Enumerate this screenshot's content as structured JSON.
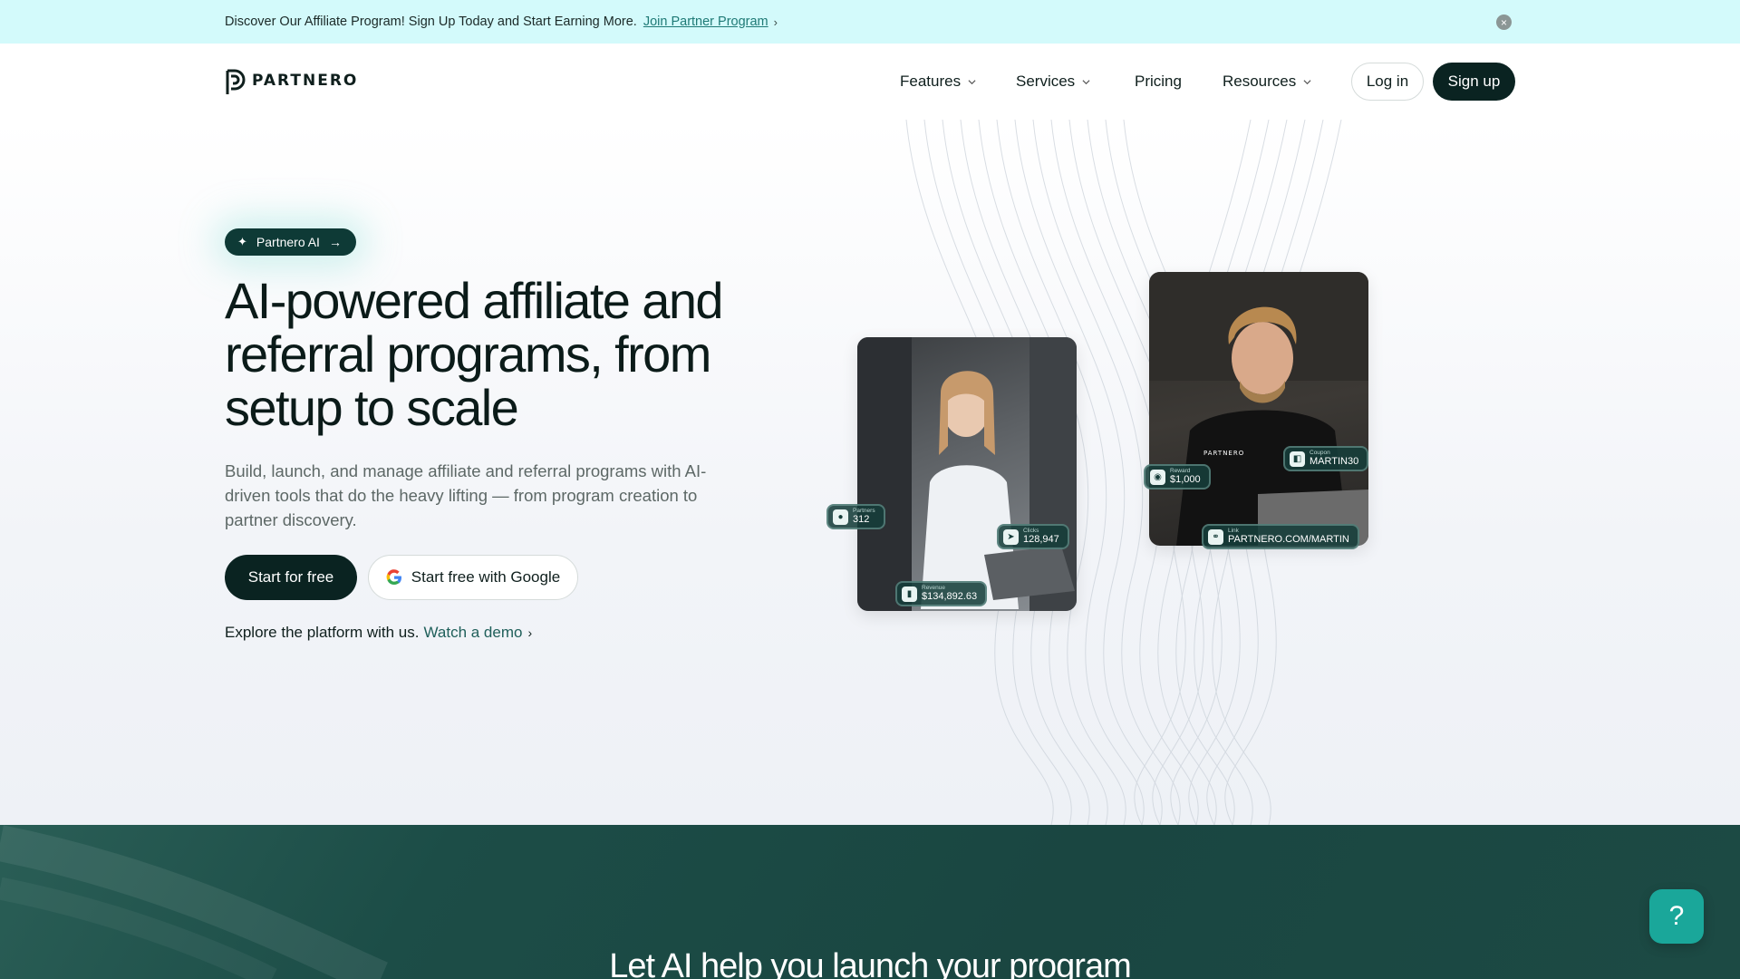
{
  "announcement": {
    "text": "Discover Our Affiliate Program! Sign Up Today and Start Earning More.",
    "link": "Join Partner Program",
    "close_icon": "close-icon"
  },
  "header": {
    "logo_text": "PARTNERO",
    "nav": [
      {
        "label": "Features",
        "has_dropdown": true
      },
      {
        "label": "Services",
        "has_dropdown": true
      },
      {
        "label": "Pricing",
        "has_dropdown": false
      },
      {
        "label": "Resources",
        "has_dropdown": true
      }
    ],
    "login_label": "Log in",
    "signup_label": "Sign up"
  },
  "hero": {
    "pill_label": "Partnero AI",
    "title": "AI-powered affiliate and referral programs, from setup to scale",
    "subtitle": "Build, launch, and manage affiliate and referral programs with AI-driven tools that do the heavy lifting — from program creation to partner discovery.",
    "start_label": "Start for free",
    "google_label": "Start free with Google",
    "explore_text": "Explore the platform with us.",
    "demo_link": "Watch a demo"
  },
  "cards": {
    "partners": {
      "label": "Partners",
      "value": "312"
    },
    "clicks": {
      "label": "Clicks",
      "value": "128,947"
    },
    "revenue": {
      "label": "Revenue",
      "value": "$134,892.63"
    },
    "reward": {
      "label": "Reward",
      "value": "$1,000"
    },
    "coupon": {
      "label": "Coupon",
      "value": "MARTIN30"
    },
    "link": {
      "label": "Link",
      "value": "PARTNERO.COM/MARTIN"
    },
    "shirt_text": "PARTNERO"
  },
  "bottom": {
    "title": "Let AI help you launch your program"
  },
  "help": {
    "label": "?"
  },
  "colors": {
    "announce_bg": "#d3fafb",
    "primary_dark": "#0a2321",
    "accent_teal": "#1aa79a",
    "section_green": "#1a4641"
  }
}
